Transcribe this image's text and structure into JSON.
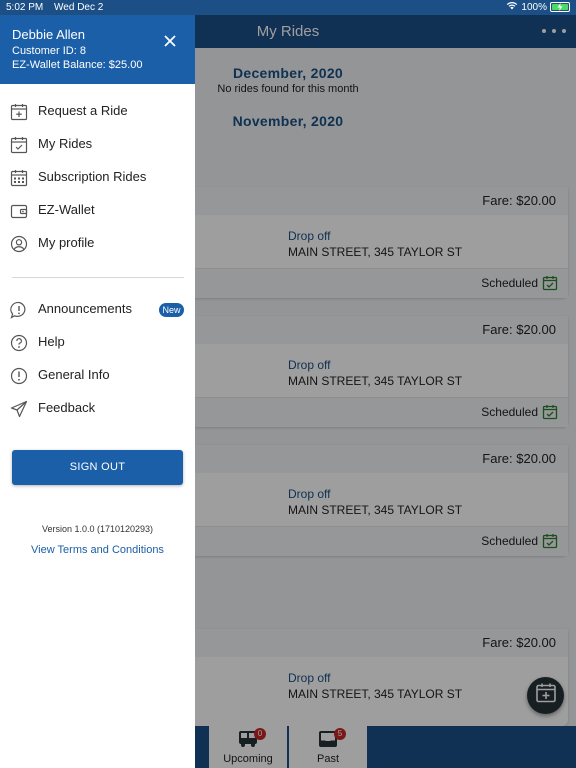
{
  "status_bar": {
    "time": "5:02 PM",
    "date": "Wed Dec 2",
    "battery": "100%"
  },
  "header": {
    "title": "My Rides"
  },
  "months": [
    {
      "label": "December, 2020",
      "note": "No rides found for this month"
    },
    {
      "label": "November, 2020"
    }
  ],
  "rides": [
    {
      "fare": "Fare: $20.00",
      "dropoff_label": "Drop off",
      "dropoff_address": "MAIN STREET, 345 TAYLOR ST",
      "status": "Scheduled"
    },
    {
      "fare": "Fare: $20.00",
      "dropoff_label": "Drop off",
      "dropoff_address": "MAIN STREET, 345 TAYLOR ST",
      "status": "Scheduled"
    },
    {
      "fare": "Fare: $20.00",
      "dropoff_label": "Drop off",
      "dropoff_address": "MAIN STREET, 345 TAYLOR ST",
      "status": "Scheduled"
    },
    {
      "fare": "Fare: $20.00",
      "dropoff_label": "Drop off",
      "dropoff_address": "MAIN STREET, 345 TAYLOR ST"
    }
  ],
  "tabs": [
    {
      "label": "Upcoming",
      "badge": "0",
      "icon": "bus-icon"
    },
    {
      "label": "Past",
      "badge": "5",
      "icon": "inbox-icon"
    }
  ],
  "drawer": {
    "user_name": "Debbie Allen",
    "customer_id": "Customer ID: 8",
    "wallet_balance": "EZ-Wallet Balance: $25.00",
    "menu": [
      {
        "label": "Request a Ride",
        "icon": "calendar-plus-icon"
      },
      {
        "label": "My Rides",
        "icon": "calendar-check-icon"
      },
      {
        "label": "Subscription Rides",
        "icon": "calendar-grid-icon"
      },
      {
        "label": "EZ-Wallet",
        "icon": "wallet-icon"
      },
      {
        "label": "My profile",
        "icon": "user-icon"
      }
    ],
    "secondary_menu": [
      {
        "label": "Announcements",
        "icon": "announcement-icon",
        "badge": "New"
      },
      {
        "label": "Help",
        "icon": "help-icon"
      },
      {
        "label": "General Info",
        "icon": "info-icon"
      },
      {
        "label": "Feedback",
        "icon": "send-icon"
      }
    ],
    "sign_out": "SIGN OUT",
    "version": "Version 1.0.0 (1710120293)",
    "terms": "View Terms and Conditions"
  },
  "colors": {
    "primary": "#1b5fa8",
    "header": "#1b4f86",
    "scheduled": "#2e7d32",
    "badge": "#c62828"
  }
}
